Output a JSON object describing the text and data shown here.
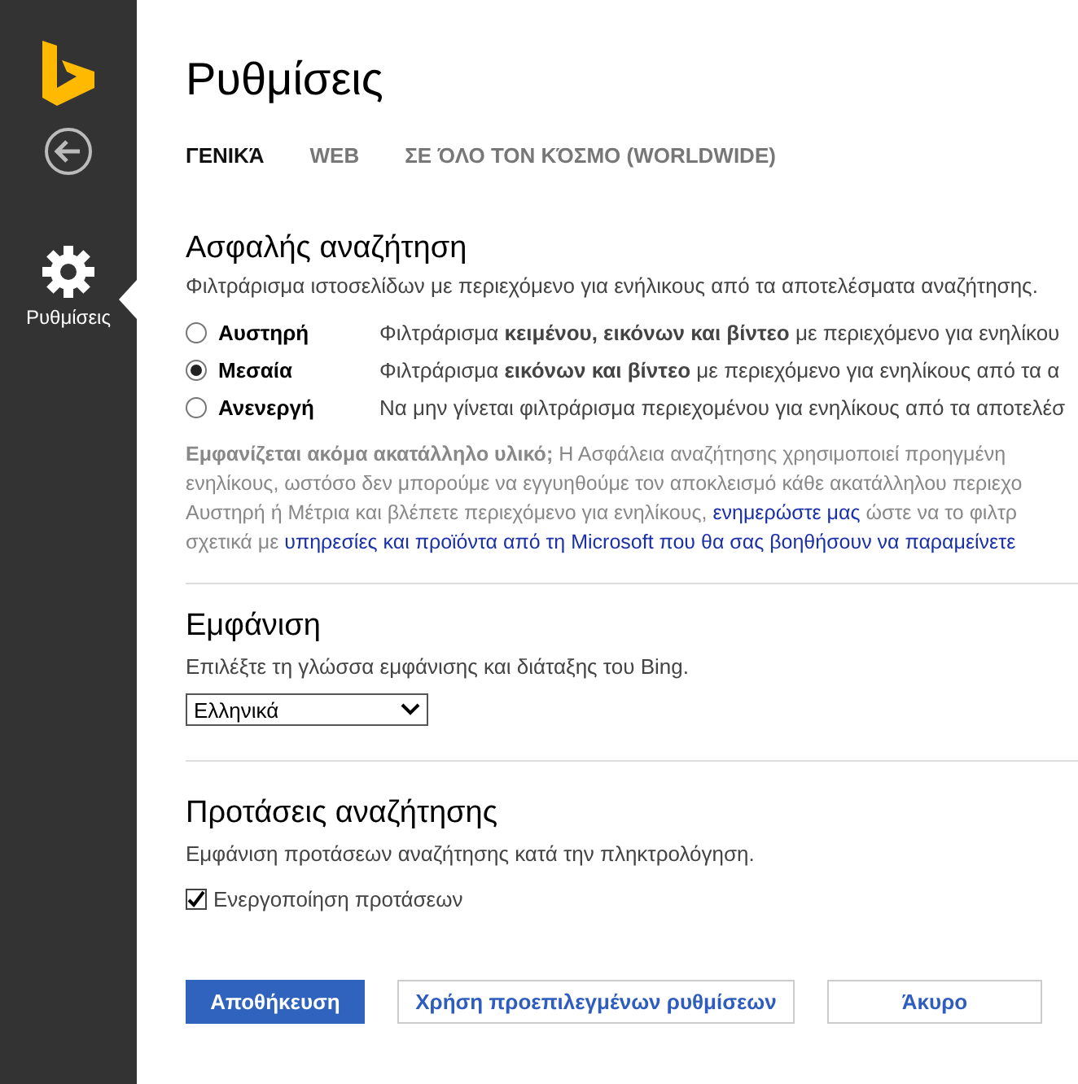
{
  "sidebar": {
    "items": [
      {
        "label": "Ρυθμίσεις",
        "selected": true
      }
    ]
  },
  "title": "Ρυθμίσεις",
  "tabs": [
    {
      "label": "ΓΕΝΙΚΆ",
      "selected": true
    },
    {
      "label": "WEB",
      "selected": false
    },
    {
      "label": "ΣΕ ΌΛΟ ΤΟΝ ΚΌΣΜΟ (WORLDWIDE)",
      "selected": false
    }
  ],
  "safe_search": {
    "heading": "Ασφαλής αναζήτηση",
    "description": "Φιλτράρισμα ιστοσελίδων με περιεχόμενο για ενήλικους από τα αποτελέσματα αναζήτησης.",
    "options": [
      {
        "label": "Αυστηρή",
        "selected": false,
        "description": "Φιλτράρισμα **κειμένου, εικόνων και βίντεο** με περιεχόμενο για ενηλίκου"
      },
      {
        "label": "Μεσαία",
        "selected": true,
        "description": "Φιλτράρισμα **εικόνων και βίντεο** με περιεχόμενο για ενηλίκους από τα α"
      },
      {
        "label": "Ανενεργή",
        "selected": false,
        "description": "Να μην γίνεται φιλτράρισμα περιεχομένου για ενηλίκους από τα αποτελέσ"
      }
    ],
    "note_lines": [
      [
        {
          "kind": "text",
          "text": "**Εμφανίζεται ακόμα ακατάλληλο υλικό;** Η Ασφάλεια αναζήτησης χρησιμοποιεί προηγμένη"
        }
      ],
      [
        {
          "kind": "text",
          "text": "ενηλίκους, ωστόσο δεν μπορούμε να εγγυηθούμε τον αποκλεισμό κάθε ακατάλληλου περιεχο"
        }
      ],
      [
        {
          "kind": "text",
          "text": "Αυστηρή ή Μέτρια και βλέπετε περιεχόμενο για ενηλίκους, "
        },
        {
          "kind": "link",
          "text": "ενημερώστε μας"
        },
        {
          "kind": "text",
          "text": " ώστε να το φιλτρ"
        }
      ],
      [
        {
          "kind": "text",
          "text": "σχετικά με "
        },
        {
          "kind": "link",
          "text": "υπηρεσίες και προϊόντα από τη Microsoft που θα σας βοηθήσουν να παραμείνετε"
        }
      ]
    ]
  },
  "display": {
    "heading": "Εμφάνιση",
    "description": "Επιλέξτε τη γλώσσα εμφάνισης και διάταξης του Bing.",
    "language": "Ελληνικά"
  },
  "suggestions": {
    "heading": "Προτάσεις αναζήτησης",
    "description": "Εμφάνιση προτάσεων αναζήτησης κατά την πληκτρολόγηση.",
    "checkbox": {
      "label": "Ενεργοποίηση προτάσεων",
      "checked": true
    }
  },
  "buttons": [
    {
      "label": "Αποθήκευση",
      "kind": "primary"
    },
    {
      "label": "Χρήση προεπιλεγμένων ρυθμίσεων",
      "kind": "secondary"
    },
    {
      "label": "Άκυρο",
      "kind": "secondary"
    }
  ]
}
